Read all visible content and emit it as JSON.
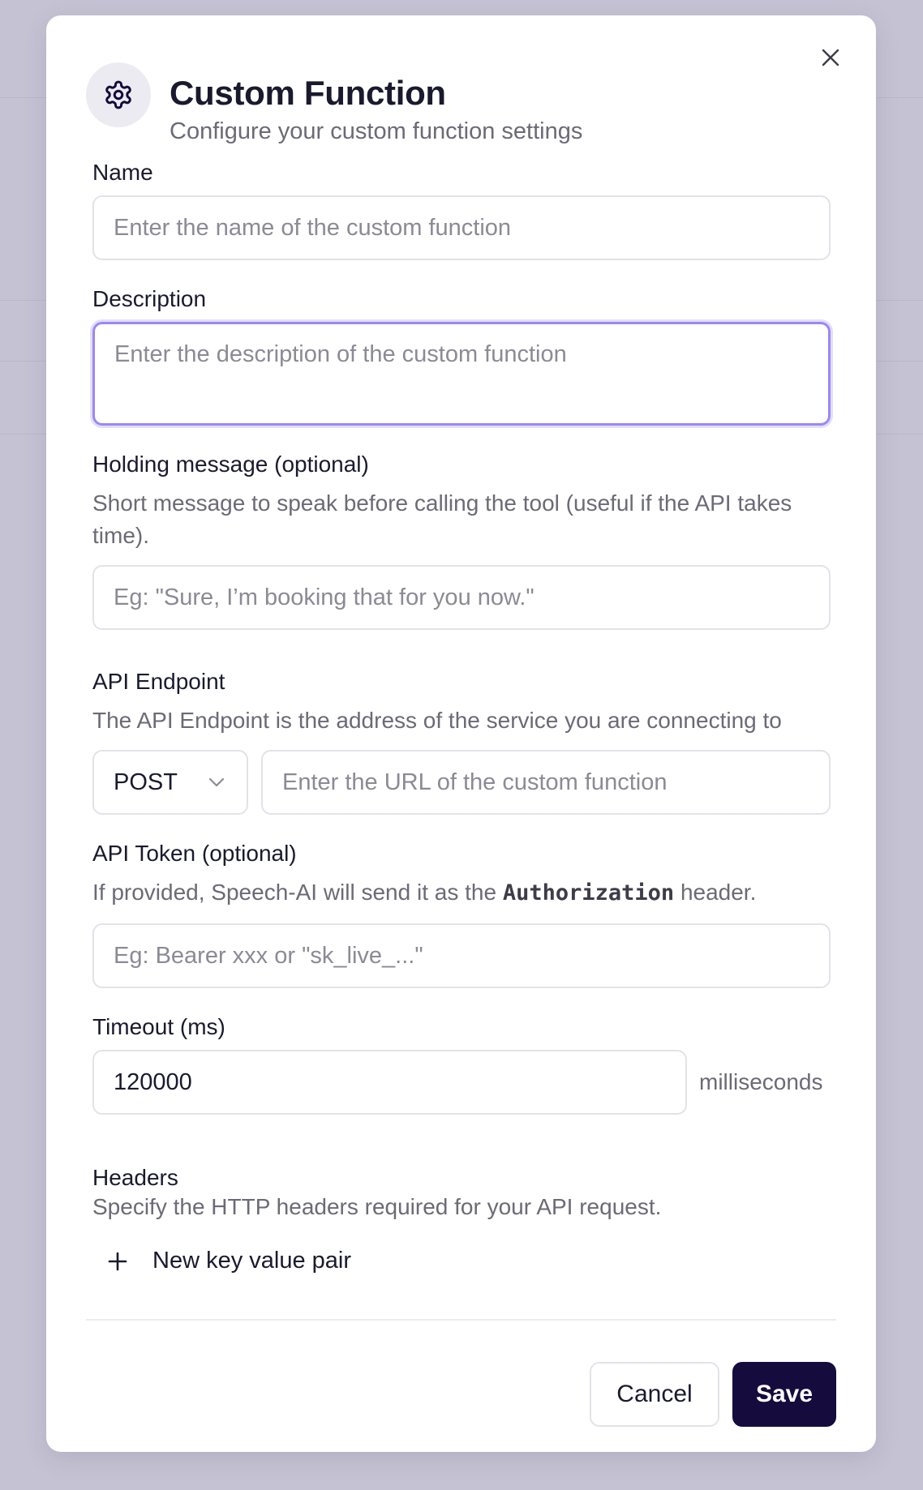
{
  "dialog": {
    "title": "Custom Function",
    "subtitle": "Configure your custom function settings",
    "icon": "gear-icon",
    "close_icon": "close-icon"
  },
  "form": {
    "name": {
      "label": "Name",
      "placeholder": "Enter the name of the custom function",
      "value": ""
    },
    "description": {
      "label": "Description",
      "placeholder": "Enter the description of the custom function",
      "value": ""
    },
    "holding_message": {
      "label": "Holding message (optional)",
      "help": "Short message to speak before calling the tool (useful if the API takes time).",
      "placeholder": "Eg: \"Sure, I’m booking that for you now.\"",
      "value": ""
    },
    "api_endpoint": {
      "label": "API Endpoint",
      "help": "The API Endpoint is the address of the service you are connecting to",
      "method": "POST",
      "url_placeholder": "Enter the URL of the custom function",
      "url_value": ""
    },
    "api_token": {
      "label": "API Token (optional)",
      "help_prefix": "If provided, Speech-AI will send it as the",
      "help_code": "Authorization",
      "help_suffix": "header.",
      "placeholder": "Eg: Bearer xxx or \"sk_live_...\"",
      "value": ""
    },
    "timeout": {
      "label": "Timeout (ms)",
      "value": "120000",
      "unit": "milliseconds"
    },
    "headers": {
      "label": "Headers",
      "help": "Specify the HTTP headers required for your API request.",
      "add_label": "New key value pair"
    }
  },
  "footer": {
    "cancel_label": "Cancel",
    "save_label": "Save"
  },
  "colors": {
    "focus_ring": "#9b87f5",
    "primary_button": "#150b3d",
    "backdrop": "#c5c3d3"
  }
}
